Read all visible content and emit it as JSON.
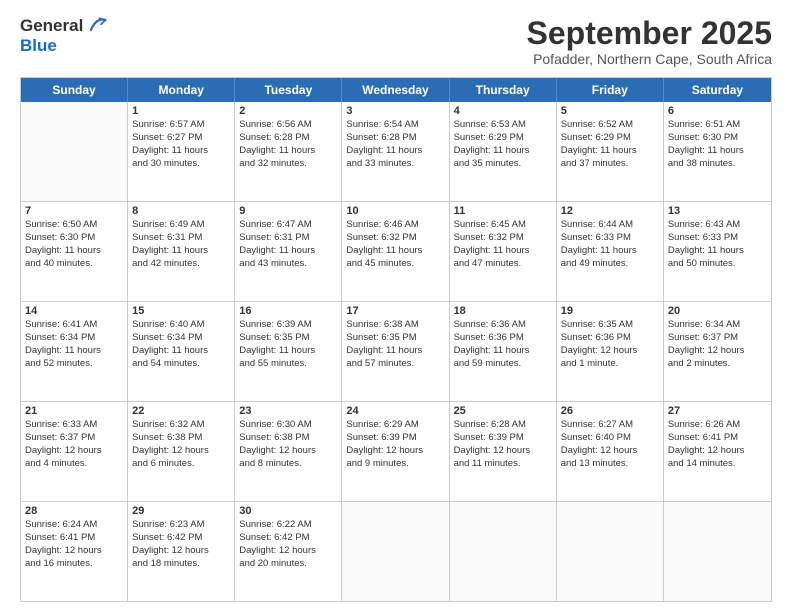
{
  "header": {
    "logo": {
      "line1": "General",
      "line2": "Blue"
    },
    "month": "September 2025",
    "location": "Pofadder, Northern Cape, South Africa"
  },
  "weekdays": [
    "Sunday",
    "Monday",
    "Tuesday",
    "Wednesday",
    "Thursday",
    "Friday",
    "Saturday"
  ],
  "weeks": [
    [
      {
        "day": "",
        "lines": []
      },
      {
        "day": "1",
        "lines": [
          "Sunrise: 6:57 AM",
          "Sunset: 6:27 PM",
          "Daylight: 11 hours",
          "and 30 minutes."
        ]
      },
      {
        "day": "2",
        "lines": [
          "Sunrise: 6:56 AM",
          "Sunset: 6:28 PM",
          "Daylight: 11 hours",
          "and 32 minutes."
        ]
      },
      {
        "day": "3",
        "lines": [
          "Sunrise: 6:54 AM",
          "Sunset: 6:28 PM",
          "Daylight: 11 hours",
          "and 33 minutes."
        ]
      },
      {
        "day": "4",
        "lines": [
          "Sunrise: 6:53 AM",
          "Sunset: 6:29 PM",
          "Daylight: 11 hours",
          "and 35 minutes."
        ]
      },
      {
        "day": "5",
        "lines": [
          "Sunrise: 6:52 AM",
          "Sunset: 6:29 PM",
          "Daylight: 11 hours",
          "and 37 minutes."
        ]
      },
      {
        "day": "6",
        "lines": [
          "Sunrise: 6:51 AM",
          "Sunset: 6:30 PM",
          "Daylight: 11 hours",
          "and 38 minutes."
        ]
      }
    ],
    [
      {
        "day": "7",
        "lines": [
          "Sunrise: 6:50 AM",
          "Sunset: 6:30 PM",
          "Daylight: 11 hours",
          "and 40 minutes."
        ]
      },
      {
        "day": "8",
        "lines": [
          "Sunrise: 6:49 AM",
          "Sunset: 6:31 PM",
          "Daylight: 11 hours",
          "and 42 minutes."
        ]
      },
      {
        "day": "9",
        "lines": [
          "Sunrise: 6:47 AM",
          "Sunset: 6:31 PM",
          "Daylight: 11 hours",
          "and 43 minutes."
        ]
      },
      {
        "day": "10",
        "lines": [
          "Sunrise: 6:46 AM",
          "Sunset: 6:32 PM",
          "Daylight: 11 hours",
          "and 45 minutes."
        ]
      },
      {
        "day": "11",
        "lines": [
          "Sunrise: 6:45 AM",
          "Sunset: 6:32 PM",
          "Daylight: 11 hours",
          "and 47 minutes."
        ]
      },
      {
        "day": "12",
        "lines": [
          "Sunrise: 6:44 AM",
          "Sunset: 6:33 PM",
          "Daylight: 11 hours",
          "and 49 minutes."
        ]
      },
      {
        "day": "13",
        "lines": [
          "Sunrise: 6:43 AM",
          "Sunset: 6:33 PM",
          "Daylight: 11 hours",
          "and 50 minutes."
        ]
      }
    ],
    [
      {
        "day": "14",
        "lines": [
          "Sunrise: 6:41 AM",
          "Sunset: 6:34 PM",
          "Daylight: 11 hours",
          "and 52 minutes."
        ]
      },
      {
        "day": "15",
        "lines": [
          "Sunrise: 6:40 AM",
          "Sunset: 6:34 PM",
          "Daylight: 11 hours",
          "and 54 minutes."
        ]
      },
      {
        "day": "16",
        "lines": [
          "Sunrise: 6:39 AM",
          "Sunset: 6:35 PM",
          "Daylight: 11 hours",
          "and 55 minutes."
        ]
      },
      {
        "day": "17",
        "lines": [
          "Sunrise: 6:38 AM",
          "Sunset: 6:35 PM",
          "Daylight: 11 hours",
          "and 57 minutes."
        ]
      },
      {
        "day": "18",
        "lines": [
          "Sunrise: 6:36 AM",
          "Sunset: 6:36 PM",
          "Daylight: 11 hours",
          "and 59 minutes."
        ]
      },
      {
        "day": "19",
        "lines": [
          "Sunrise: 6:35 AM",
          "Sunset: 6:36 PM",
          "Daylight: 12 hours",
          "and 1 minute."
        ]
      },
      {
        "day": "20",
        "lines": [
          "Sunrise: 6:34 AM",
          "Sunset: 6:37 PM",
          "Daylight: 12 hours",
          "and 2 minutes."
        ]
      }
    ],
    [
      {
        "day": "21",
        "lines": [
          "Sunrise: 6:33 AM",
          "Sunset: 6:37 PM",
          "Daylight: 12 hours",
          "and 4 minutes."
        ]
      },
      {
        "day": "22",
        "lines": [
          "Sunrise: 6:32 AM",
          "Sunset: 6:38 PM",
          "Daylight: 12 hours",
          "and 6 minutes."
        ]
      },
      {
        "day": "23",
        "lines": [
          "Sunrise: 6:30 AM",
          "Sunset: 6:38 PM",
          "Daylight: 12 hours",
          "and 8 minutes."
        ]
      },
      {
        "day": "24",
        "lines": [
          "Sunrise: 6:29 AM",
          "Sunset: 6:39 PM",
          "Daylight: 12 hours",
          "and 9 minutes."
        ]
      },
      {
        "day": "25",
        "lines": [
          "Sunrise: 6:28 AM",
          "Sunset: 6:39 PM",
          "Daylight: 12 hours",
          "and 11 minutes."
        ]
      },
      {
        "day": "26",
        "lines": [
          "Sunrise: 6:27 AM",
          "Sunset: 6:40 PM",
          "Daylight: 12 hours",
          "and 13 minutes."
        ]
      },
      {
        "day": "27",
        "lines": [
          "Sunrise: 6:26 AM",
          "Sunset: 6:41 PM",
          "Daylight: 12 hours",
          "and 14 minutes."
        ]
      }
    ],
    [
      {
        "day": "28",
        "lines": [
          "Sunrise: 6:24 AM",
          "Sunset: 6:41 PM",
          "Daylight: 12 hours",
          "and 16 minutes."
        ]
      },
      {
        "day": "29",
        "lines": [
          "Sunrise: 6:23 AM",
          "Sunset: 6:42 PM",
          "Daylight: 12 hours",
          "and 18 minutes."
        ]
      },
      {
        "day": "30",
        "lines": [
          "Sunrise: 6:22 AM",
          "Sunset: 6:42 PM",
          "Daylight: 12 hours",
          "and 20 minutes."
        ]
      },
      {
        "day": "",
        "lines": []
      },
      {
        "day": "",
        "lines": []
      },
      {
        "day": "",
        "lines": []
      },
      {
        "day": "",
        "lines": []
      }
    ]
  ]
}
